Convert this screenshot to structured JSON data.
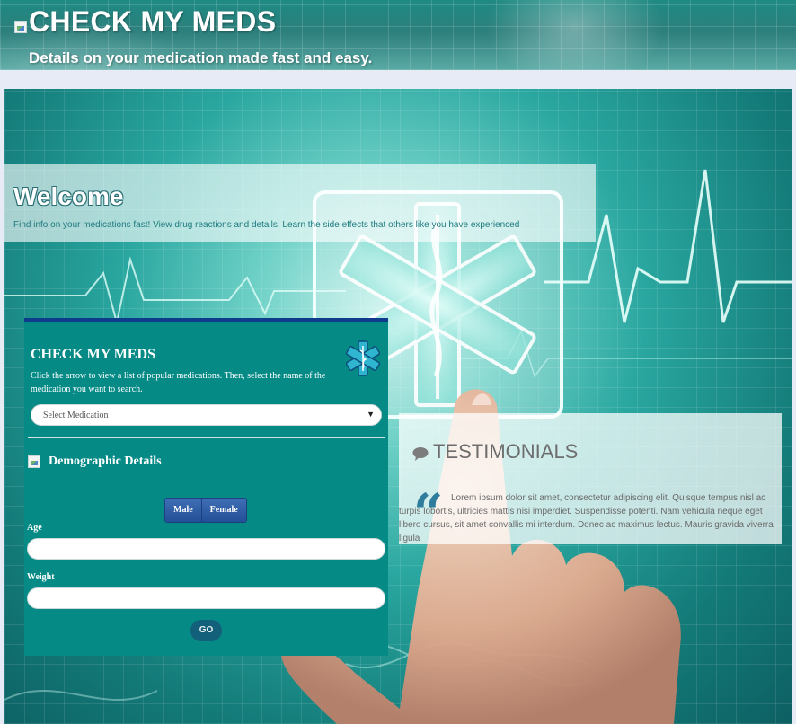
{
  "header": {
    "title": "CHECK MY MEDS",
    "tagline": "Details on your medication made fast and easy."
  },
  "welcome": {
    "heading": "Welcome",
    "text": "Find info on your medications fast! View drug reactions and details. Learn the side effects that others like you have experienced"
  },
  "form": {
    "title": "CHECK MY MEDS",
    "instructions": "Click the arrow to view a list of popular medications. Then, select the name of the medication you want to search.",
    "select": {
      "selected": "Select Medication",
      "arrow": "▼"
    },
    "demographics": {
      "title": "Demographic Details",
      "gender_options": [
        "Male",
        "Female"
      ],
      "age_label": "Age",
      "age_value": "",
      "weight_label": "Weight",
      "weight_value": ""
    },
    "go_label": "GO"
  },
  "testimonials": {
    "heading": "TESTIMONIALS",
    "quote_mark": "“",
    "text": "Lorem ipsum dolor sit amet, consectetur adipiscing elit. Quisque tempus nisl ac turpis lobortis, ultricies mattis nisi imperdiet. Suspendisse potenti. Nam vehicula neque eget libero cursus, sit amet convallis mi interdum. Donec ac maximus lectus. Mauris gravida viverra ligula"
  },
  "icons": {
    "header_logo": "broken-image-icon",
    "form_logo": "star-of-life-icon",
    "demographics": "broken-image-icon",
    "testimonials": "speech-bubble-icon",
    "quote": "quote-icon"
  },
  "colors": {
    "form_bg": "#058a86",
    "form_top_border": "#0e3b8a",
    "gender_button": "#2f5ea6",
    "go_button": "#13607a",
    "quote": "#2f7d9c"
  }
}
